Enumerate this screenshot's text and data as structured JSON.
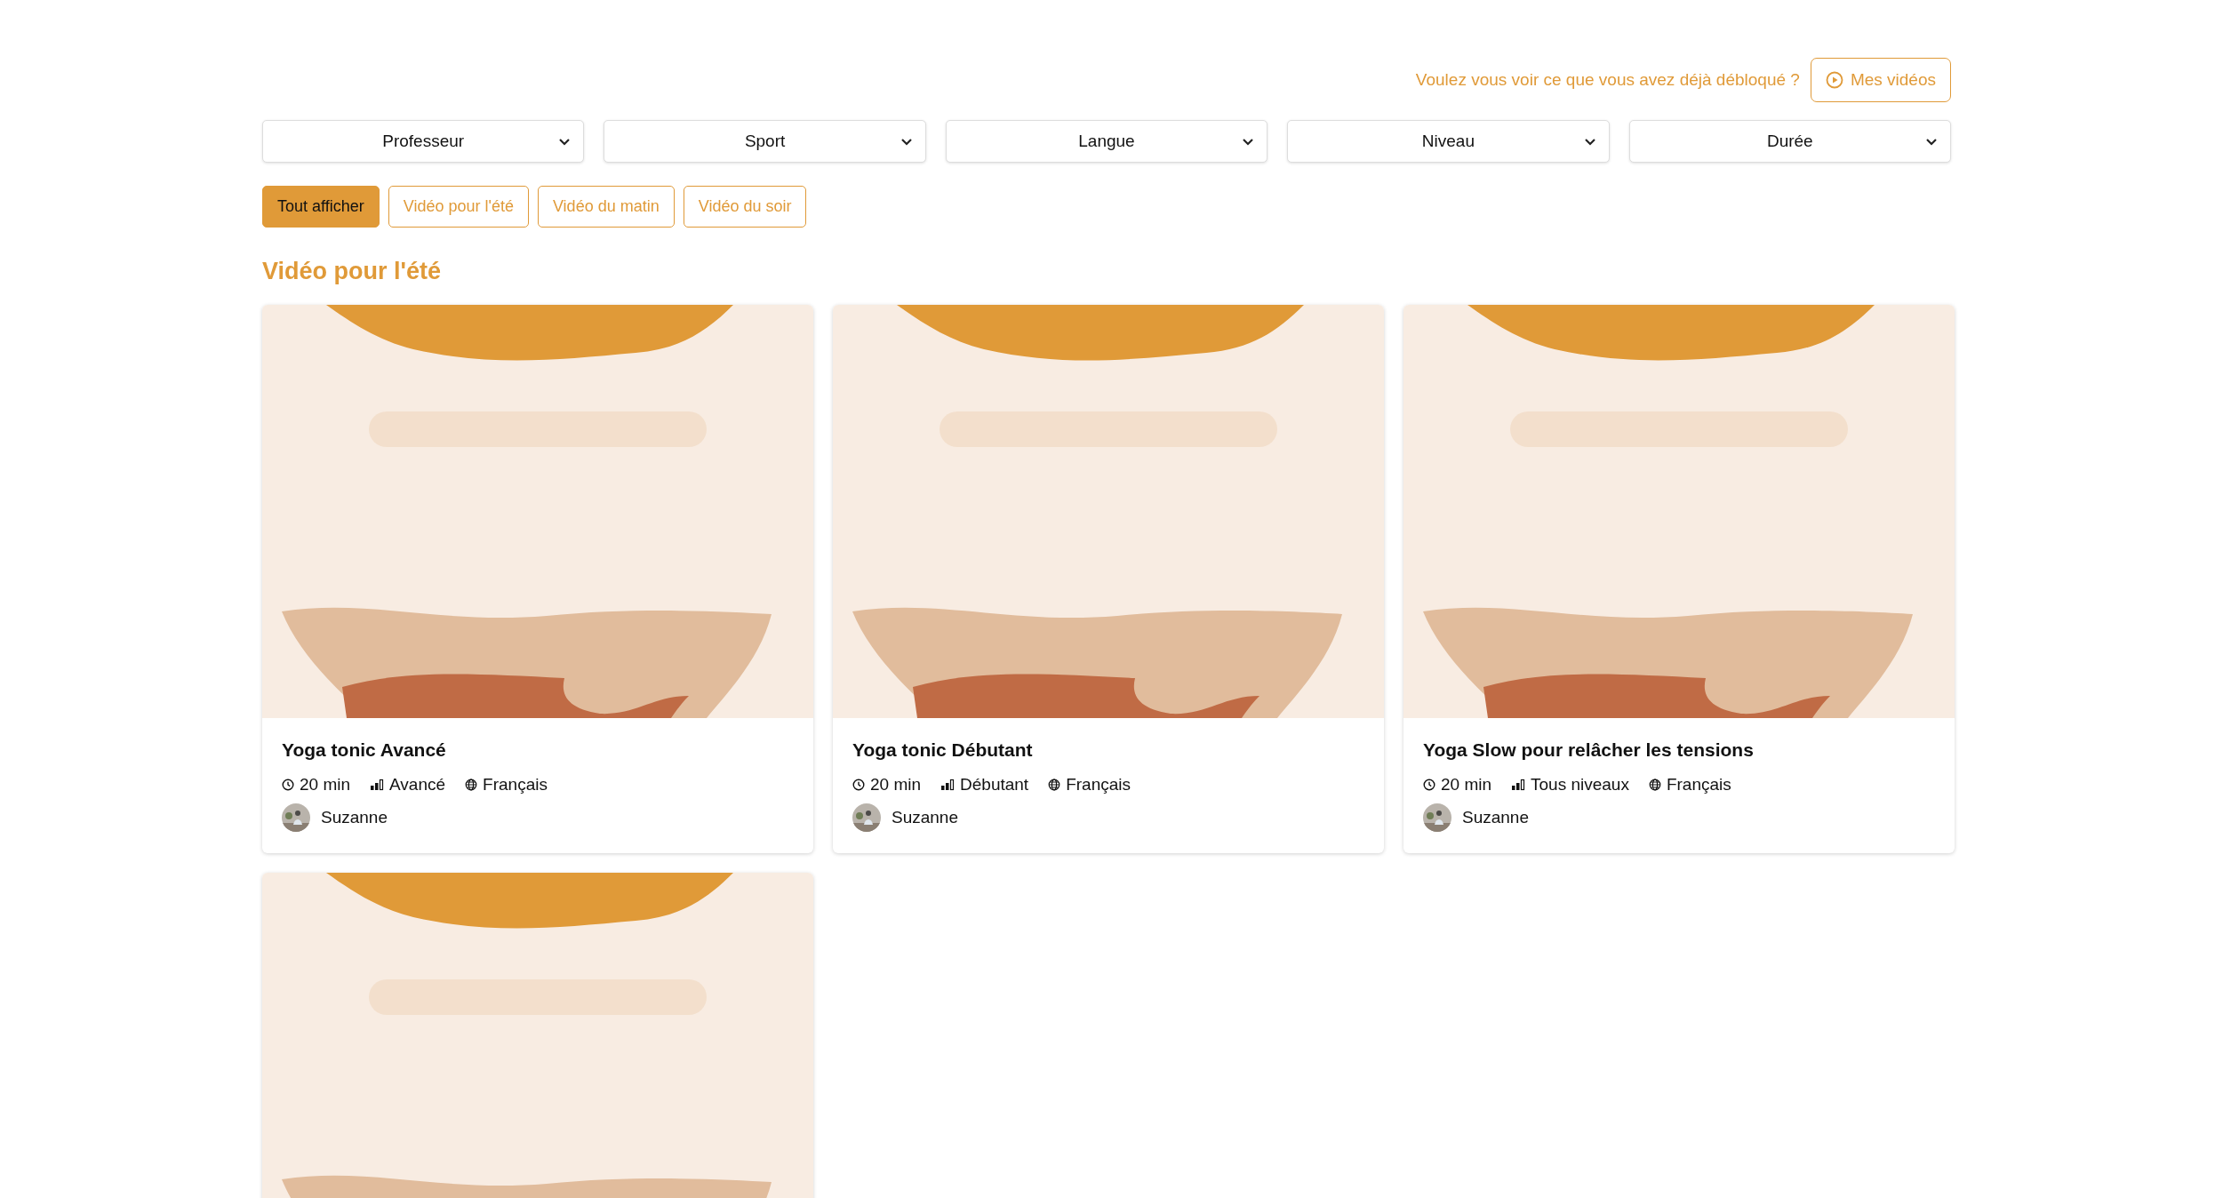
{
  "unlock": {
    "question": "Voulez vous voir ce que vous avez déjà débloqué ?",
    "button": "Mes vidéos"
  },
  "filters": [
    {
      "label": "Professeur"
    },
    {
      "label": "Sport"
    },
    {
      "label": "Langue"
    },
    {
      "label": "Niveau"
    },
    {
      "label": "Durée"
    }
  ],
  "chips": [
    {
      "label": "Tout afficher",
      "selected": true
    },
    {
      "label": "Vidéo pour l'été",
      "selected": false
    },
    {
      "label": "Vidéo du matin",
      "selected": false
    },
    {
      "label": "Vidéo du soir",
      "selected": false
    }
  ],
  "section_title": "Vidéo pour l'été",
  "videos": [
    {
      "thumbnail": {
        "kind": "picture"
      },
      "title": "Yoga tonic Avancé",
      "duration": "20 min",
      "level": "Avancé",
      "language": "Français",
      "teacher": "Suzanne"
    },
    {
      "thumbnail": {
        "kind": "picture"
      },
      "title": "Yoga tonic Débutant",
      "duration": "20 min",
      "level": "Débutant",
      "language": "Français",
      "teacher": "Suzanne"
    },
    {
      "thumbnail": {
        "kind": "picture"
      },
      "title": "Yoga Slow pour relâcher les tensions",
      "duration": "20 min",
      "level": "Tous niveaux",
      "language": "Français",
      "teacher": "Suzanne"
    },
    {
      "thumbnail": {
        "kind": "picture"
      }
    }
  ]
}
